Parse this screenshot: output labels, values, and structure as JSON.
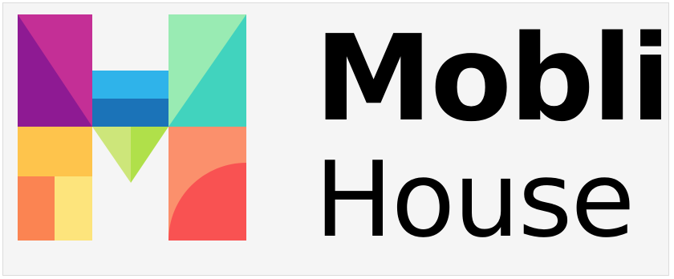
{
  "brand": {
    "name_line1": "Mobli",
    "name_line2": "House"
  },
  "logo": {
    "icon": "mobli-house-m-logo-icon",
    "colors": {
      "purple": "#8e1a93",
      "magenta": "#c42f96",
      "sky_blue": "#2fb3ea",
      "blue": "#1b73b8",
      "mint": "#99ebb3",
      "teal": "#41d3be",
      "yellow_orange": "#fec44c",
      "light_green": "#cde67a",
      "green": "#b0e04a",
      "salmon": "#fb906c",
      "coral": "#f95252",
      "orange": "#fb8452",
      "pale_yellow": "#fde47c"
    }
  },
  "text_color": "#000000"
}
